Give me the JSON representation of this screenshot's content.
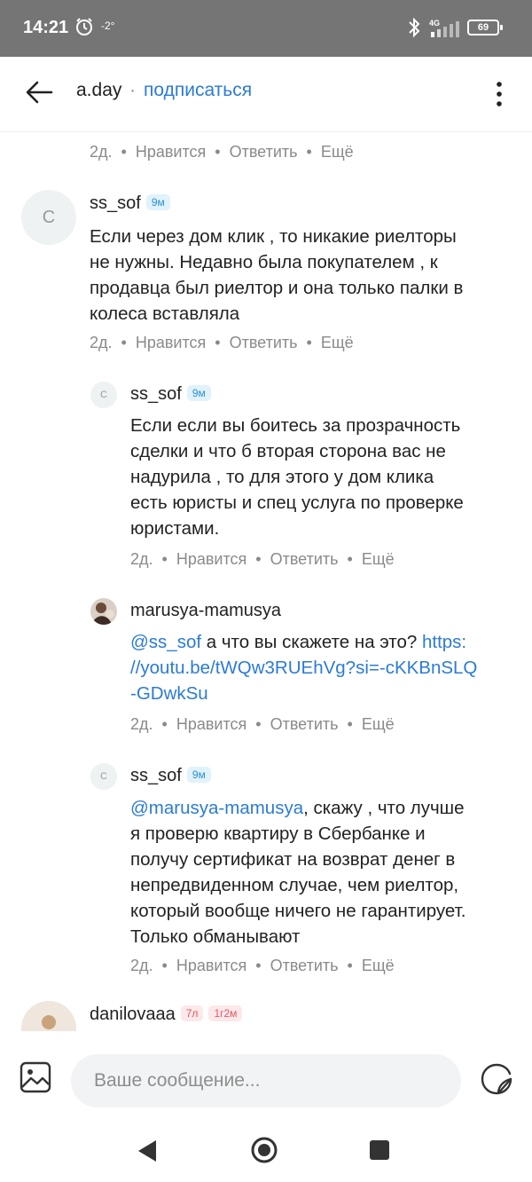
{
  "status_bar": {
    "time": "14:21",
    "temperature": "-2°",
    "network": "4G",
    "battery": "69"
  },
  "header": {
    "title": "a.day",
    "separator": "·",
    "subscribe_label": "подписаться"
  },
  "actions": {
    "time": "2д.",
    "like": "Нравится",
    "reply": "Ответить",
    "more": "Ещё",
    "separator": "•"
  },
  "comments": [
    {
      "author": "ss_sof",
      "avatar_letter": "С",
      "badge": "9м",
      "text": [
        "Если через дом клик , то никакие риелторы",
        "не нужны. Недавно была покупателем , к",
        "продавца был риелтор и она только палки в",
        "колеса вставляла"
      ]
    },
    {
      "author": "ss_sof",
      "avatar_letter": "С",
      "badge": "9м",
      "text": [
        "Если если вы боитесь за прозрачность",
        "сделки и что б вторая сторона вас не",
        "надурила , то для этого у дом клика",
        "есть юристы и спец услуга по проверке",
        "юристами."
      ]
    },
    {
      "author": "marusya-mamusya",
      "mention": "@ss_sof",
      "text_after_mention": " а что вы скажете на это? ",
      "link_line1": "https:",
      "link_line2": "//youtu.be/tWQw3RUEhVg?si=-cKKBnSLQ",
      "link_line3": "-GDwkSu"
    },
    {
      "author": "ss_sof",
      "avatar_letter": "С",
      "badge": "9м",
      "mention": "@marusya-mamusya",
      "text_line1_rest": ", скажу , что лучше",
      "text": [
        "я проверю квартиру в Сбербанке и",
        "получу сертификат на возврат денег в",
        "непредвиденном случае, чем риелтор,",
        "который вообще ничего не гарантирует.",
        "Только обманывают"
      ]
    },
    {
      "author": "danilovaaa",
      "badge1": "7л",
      "badge2": "1г2м"
    }
  ],
  "composer": {
    "placeholder": "Ваше сообщение..."
  },
  "colors": {
    "accent": "#2b7bd6",
    "badge_blue_bg": "#e1f2fb",
    "badge_red_bg": "#fde8ea",
    "status_bar": "#757575"
  }
}
